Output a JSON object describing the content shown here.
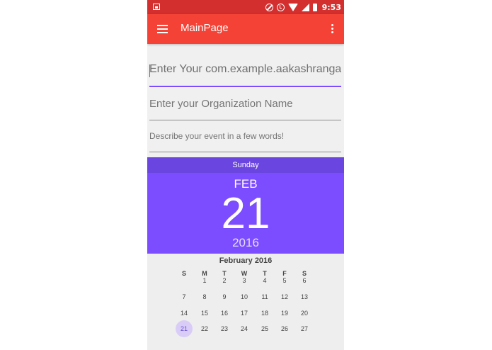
{
  "status_bar": {
    "time": "9:53",
    "icons": [
      "image-icon",
      "block-icon",
      "alarm-icon",
      "wifi-icon",
      "signal-icon",
      "battery-icon"
    ]
  },
  "app_bar": {
    "title": "MainPage",
    "menu_icon": "hamburger-icon",
    "overflow_icon": "more-vert-icon"
  },
  "form": {
    "name_field_text": "Enter Your com.example.aakashranga.e",
    "organization_placeholder": "Enter your Organization Name",
    "description_placeholder": "Describe your event in a few words!"
  },
  "date_picker": {
    "day_of_week": "Sunday",
    "month": "FEB",
    "date": "21",
    "year": "2016",
    "calendar_title": "February 2016",
    "weekdays": [
      "S",
      "M",
      "T",
      "W",
      "T",
      "F",
      "S"
    ],
    "rows": [
      [
        "",
        "1",
        "2",
        "3",
        "4",
        "5",
        "6"
      ],
      [
        "7",
        "8",
        "9",
        "10",
        "11",
        "12",
        "13"
      ],
      [
        "14",
        "15",
        "16",
        "17",
        "18",
        "19",
        "20"
      ],
      [
        "21",
        "22",
        "23",
        "24",
        "25",
        "26",
        "27"
      ]
    ],
    "selected_day": "21"
  },
  "colors": {
    "status_bar": "#d32f2f",
    "app_bar": "#f44336",
    "accent": "#7c4dff",
    "picker_day_bar": "#6b45e0"
  }
}
